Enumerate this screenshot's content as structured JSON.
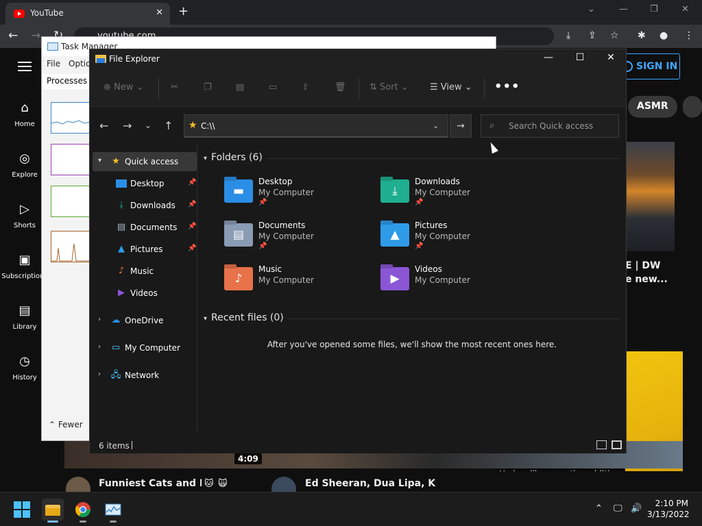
{
  "chrome": {
    "tab_title": "YouTube",
    "url": "youtube.com"
  },
  "youtube": {
    "signin": "SIGN IN",
    "chip": "ASMR",
    "nav": [
      {
        "label": "Home"
      },
      {
        "label": "Explore"
      },
      {
        "label": "Shorts"
      },
      {
        "label": "Subscriptions"
      },
      {
        "label": "Library"
      },
      {
        "label": "History"
      }
    ],
    "snippet_line1": "E | DW",
    "snippet_line2": "e new...",
    "duration": "4:09",
    "caption": "He has like an entire addition.",
    "videos": [
      {
        "title": "Funniest Cats and Dogs"
      },
      {
        "title": "Ed Sheeran, Dua Lipa, Kygo, Av"
      }
    ]
  },
  "task_manager": {
    "title": "Task Manager",
    "menu": [
      "File",
      "Optio"
    ],
    "tab": "Processes",
    "fewer": "Fewer"
  },
  "explorer": {
    "title": "File Explorer",
    "toolbar": {
      "new": "New",
      "sort": "Sort",
      "view": "View"
    },
    "address": "C:\\\\",
    "search_placeholder": "Search Quick access",
    "sidebar": [
      {
        "label": "Quick access",
        "selected": true
      },
      {
        "label": "Desktop"
      },
      {
        "label": "Downloads"
      },
      {
        "label": "Documents"
      },
      {
        "label": "Pictures"
      },
      {
        "label": "Music"
      },
      {
        "label": "Videos"
      },
      {
        "label": "OneDrive"
      },
      {
        "label": "My Computer"
      },
      {
        "label": "Network"
      }
    ],
    "folders_header": "Folders (6)",
    "folders": [
      {
        "name": "Desktop",
        "location": "My Computer",
        "pinned": true,
        "color": "#2b8ee6"
      },
      {
        "name": "Downloads",
        "location": "My Computer",
        "pinned": true,
        "color": "#1fae8f"
      },
      {
        "name": "Documents",
        "location": "My Computer",
        "pinned": true,
        "color": "#8a9bb4"
      },
      {
        "name": "Pictures",
        "location": "My Computer",
        "pinned": true,
        "color": "#2e9be8"
      },
      {
        "name": "Music",
        "location": "My Computer",
        "pinned": false,
        "color": "#e8724a"
      },
      {
        "name": "Videos",
        "location": "My Computer",
        "pinned": false,
        "color": "#8a56d6"
      }
    ],
    "recent_header": "Recent files (0)",
    "recent_message": "After you've opened some files, we'll show the most recent ones here.",
    "status": "6 items"
  },
  "taskbar": {
    "time": "2:10 PM",
    "date": "3/13/2022"
  }
}
